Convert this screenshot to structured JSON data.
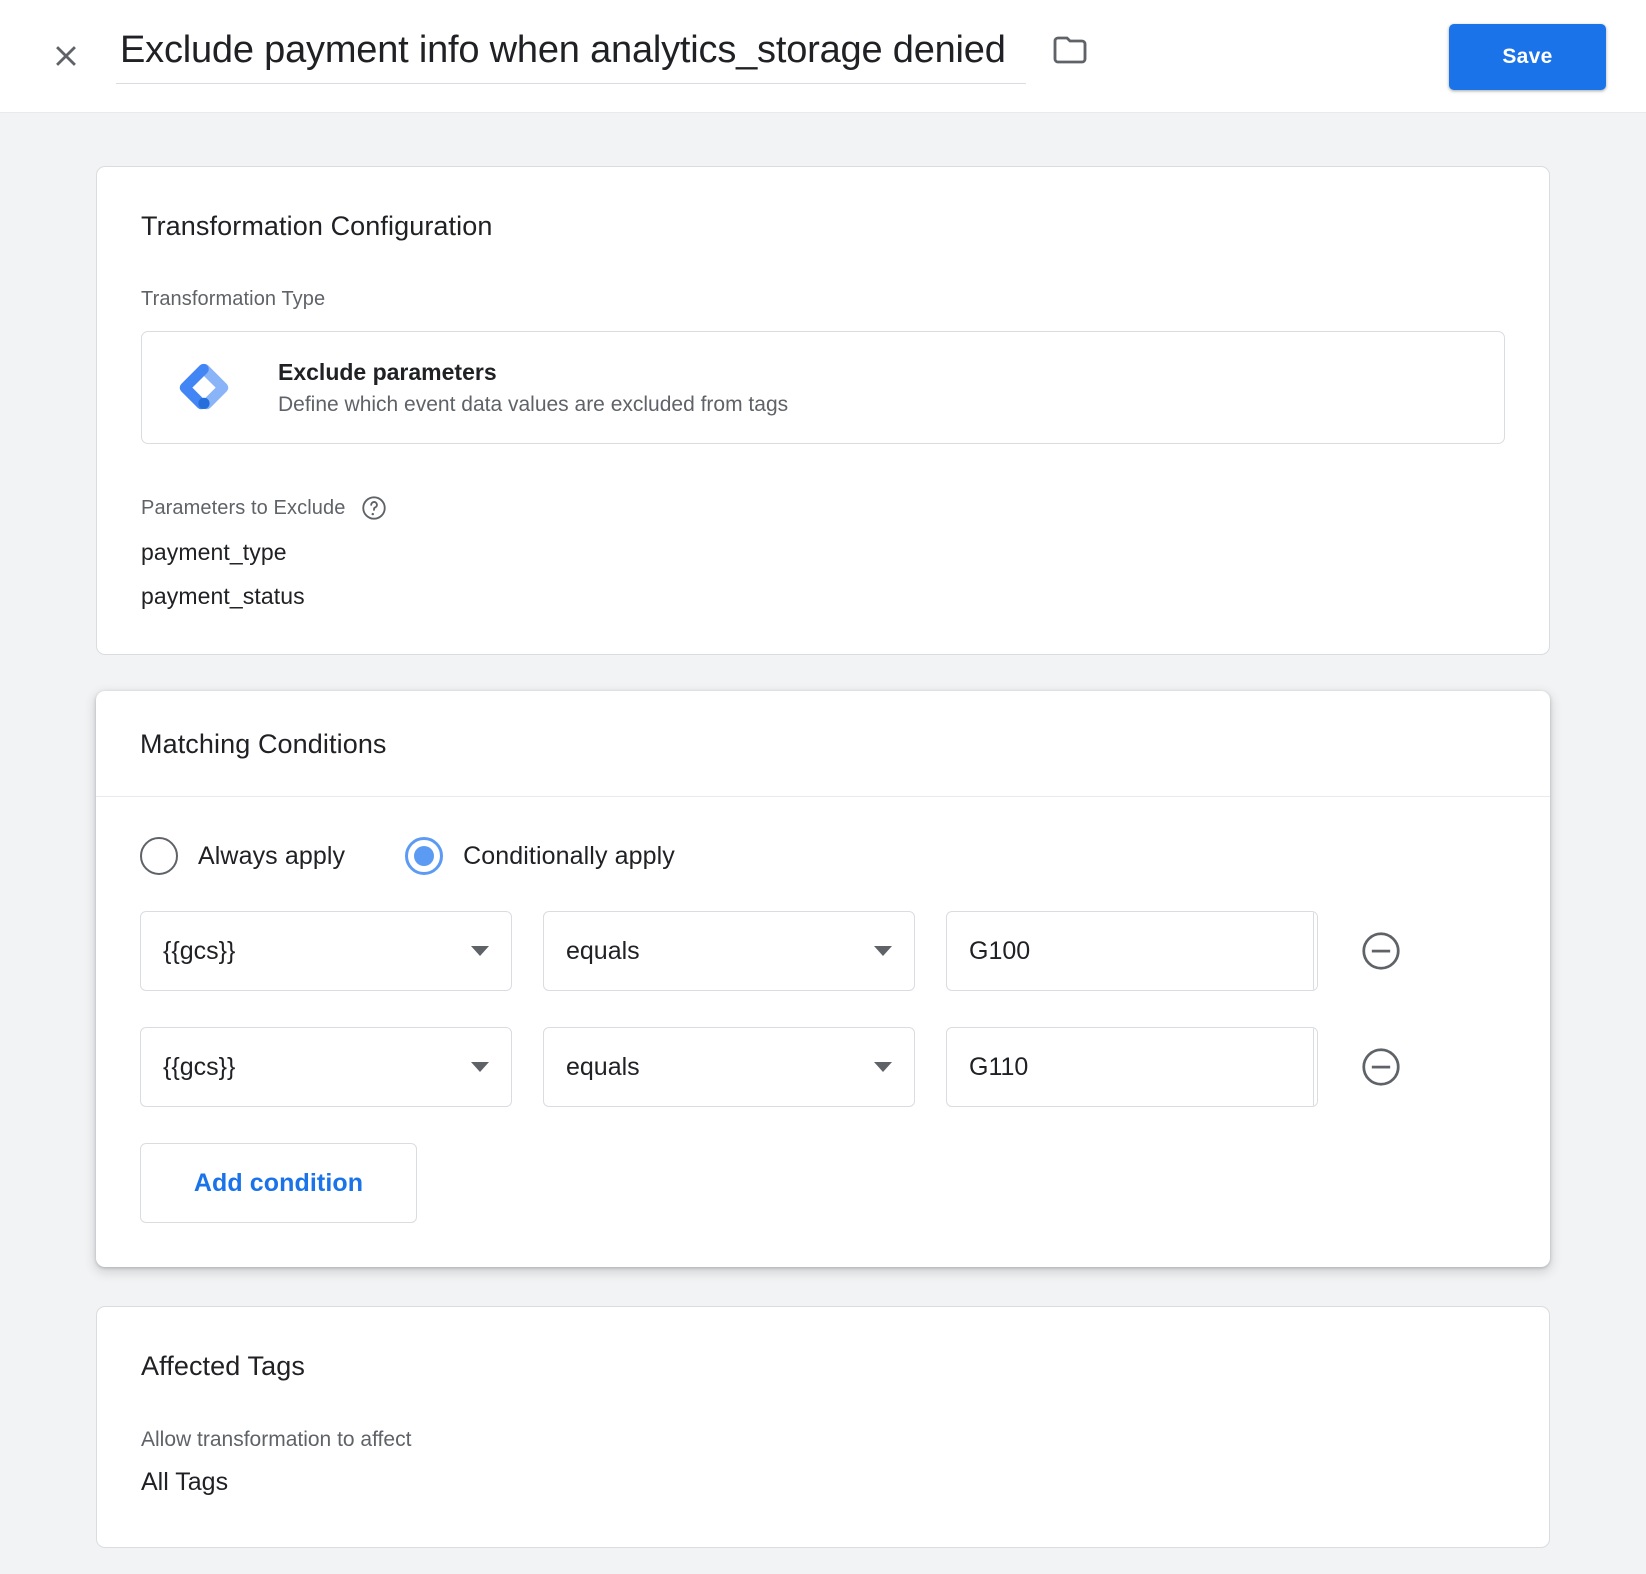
{
  "header": {
    "close_icon": "close-icon",
    "title_value": "Exclude payment info when analytics_storage denied",
    "title_placeholder": "Untitled Transformation",
    "folder_icon": "folder-icon",
    "save_label": "Save",
    "accent_color": "#1a73e8"
  },
  "transformation_card": {
    "title": "Transformation Configuration",
    "type_label": "Transformation Type",
    "selected_type": {
      "icon": "gtm-diamond-icon",
      "name": "Exclude parameters",
      "description": "Define which event data values are excluded from tags"
    },
    "params_label": "Parameters to Exclude",
    "help_icon": "help-circle-icon",
    "parameters": [
      "payment_type",
      "payment_status"
    ]
  },
  "matching_card": {
    "title": "Matching Conditions",
    "apply_modes": [
      {
        "label": "Always apply",
        "selected": false
      },
      {
        "label": "Conditionally apply",
        "selected": true
      }
    ],
    "radio_selected_color": "#5b9bf3",
    "conditions": [
      {
        "variable": "{{gcs}}",
        "operator": "equals",
        "value": "G100",
        "value_placeholder": "",
        "brick_icon": "variable-brick-icon",
        "remove_icon": "remove-circle-icon"
      },
      {
        "variable": "{{gcs}}",
        "operator": "equals",
        "value": "G110",
        "value_placeholder": "",
        "brick_icon": "variable-brick-icon",
        "remove_icon": "remove-circle-icon"
      }
    ],
    "add_condition_label": "Add condition"
  },
  "affected_card": {
    "title": "Affected Tags",
    "allow_label": "Allow transformation to affect",
    "allow_value": "All Tags"
  }
}
